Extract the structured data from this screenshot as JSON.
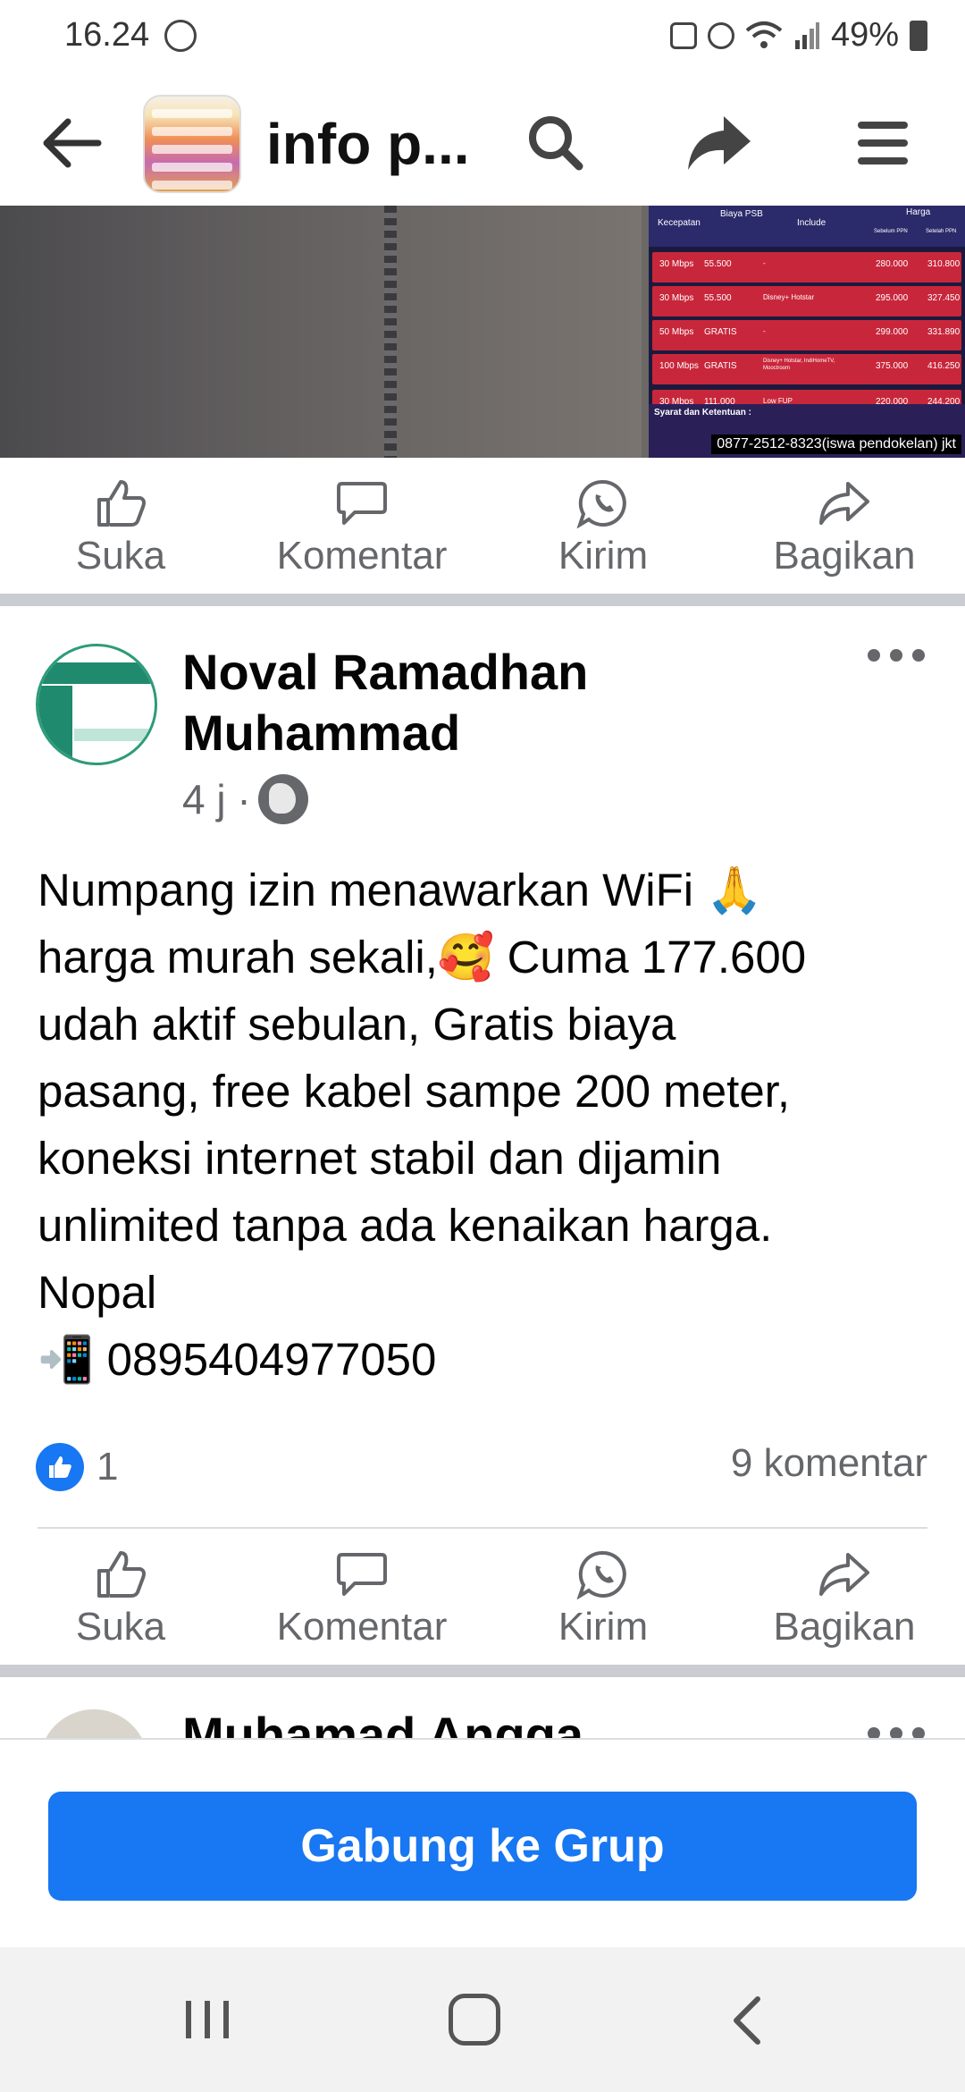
{
  "status_bar": {
    "time": "16.24",
    "battery": "49%"
  },
  "header": {
    "title": "info p..."
  },
  "top_image": {
    "table_header": [
      "Kecepatan",
      "Biaya PSB",
      "Include",
      "Harga"
    ],
    "harga_subheaders": [
      "Sebelum PPN",
      "Setelah PPN"
    ],
    "rows": [
      [
        "30 Mbps",
        "55.500",
        "-",
        "280.000",
        "310.800"
      ],
      [
        "30 Mbps",
        "55.500",
        "Disney+ Hotstar",
        "295.000",
        "327.450"
      ],
      [
        "50 Mbps",
        "GRATIS",
        "-",
        "299.000",
        "331.890"
      ],
      [
        "100 Mbps",
        "GRATIS",
        "Disney+ Hotstar, IndiHomeTV, Mooctroom",
        "375.000",
        "416.250"
      ],
      [
        "30 Mbps",
        "111.000",
        "Low FUP",
        "220.000",
        "244.200"
      ]
    ],
    "footer_title": "Syarat dan Ketentuan :",
    "phone_overlay": "0877-2512-8323(iswa pendokelan) jkt"
  },
  "actions": {
    "like": "Suka",
    "comment": "Komentar",
    "send": "Kirim",
    "share": "Bagikan"
  },
  "post": {
    "author": "Noval Ramadhan Muhammad",
    "time": "4 j ·",
    "text": "Numpang izin menawarkan WiFi 🙏\nharga murah sekali,🥰 Cuma 177.600\nudah aktif sebulan, Gratis biaya\npasang, free kabel sampe 200 meter,\nkoneksi internet stabil dan dijamin\nunlimited tanpa ada kenaikan harga.\nNopal\n📲 0895404977050",
    "reaction_count": "1",
    "comment_count": "9 komentar"
  },
  "next_post": {
    "author": "Muhamad Angga"
  },
  "join_button": "Gabung ke Grup",
  "colors": {
    "brand_blue": "#1877f2",
    "divider": "#c9ccd1",
    "secondary_text": "#65676b"
  },
  "icons": [
    "back-arrow-icon",
    "search-icon",
    "share-arrow-icon",
    "menu-icon",
    "like-icon",
    "comment-icon",
    "whatsapp-icon",
    "share-icon",
    "globe-icon",
    "more-icon"
  ]
}
